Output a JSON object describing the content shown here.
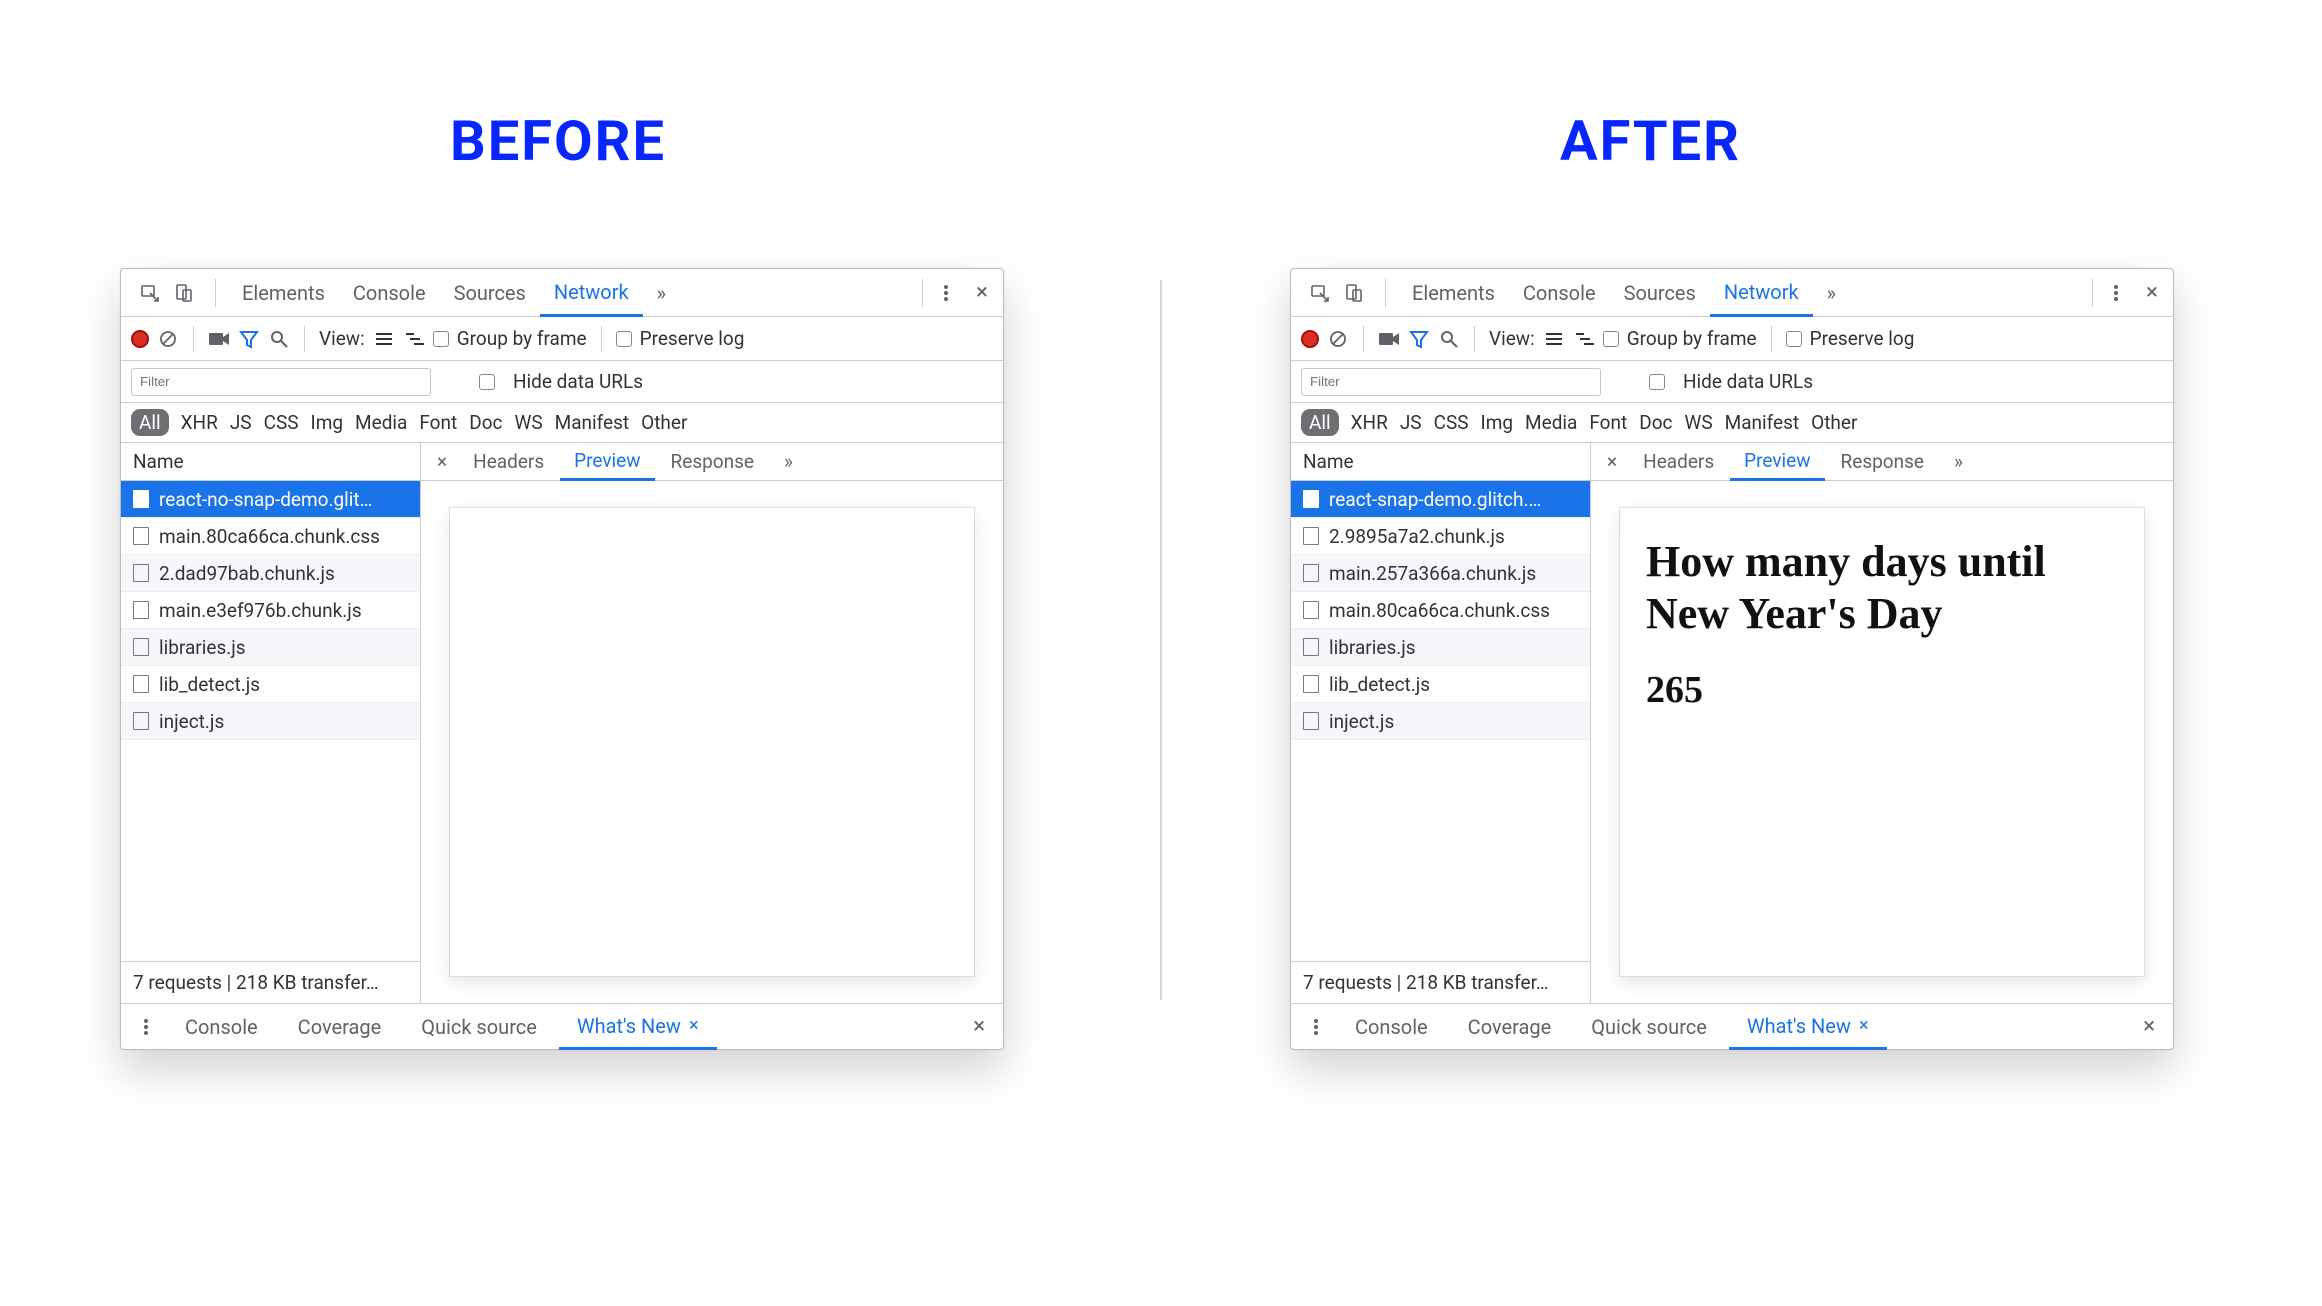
{
  "headings": {
    "before": "BEFORE",
    "after": "AFTER"
  },
  "tabs": {
    "items": [
      "Elements",
      "Console",
      "Sources",
      "Network"
    ],
    "active_index": 3,
    "more_glyph": "»"
  },
  "toolbar": {
    "view_label": "View:",
    "group_by_frame": "Group by frame",
    "preserve_log": "Preserve log"
  },
  "filter": {
    "placeholder": "Filter",
    "hide_data_urls": "Hide data URLs"
  },
  "types": {
    "items": [
      "All",
      "XHR",
      "JS",
      "CSS",
      "Img",
      "Media",
      "Font",
      "Doc",
      "WS",
      "Manifest",
      "Other"
    ],
    "active_index": 0
  },
  "detail_tabs": {
    "items": [
      "Headers",
      "Preview",
      "Response"
    ],
    "active_index": 1,
    "more_glyph": "»",
    "close_glyph": "×"
  },
  "columns": {
    "name": "Name"
  },
  "before": {
    "requests": [
      "react-no-snap-demo.glit…",
      "main.80ca66ca.chunk.css",
      "2.dad97bab.chunk.js",
      "main.e3ef976b.chunk.js",
      "libraries.js",
      "lib_detect.js",
      "inject.js"
    ],
    "selected_index": 0,
    "preview": {
      "has_content": false
    },
    "status": "7 requests | 218 KB transfer…"
  },
  "after": {
    "requests": [
      "react-snap-demo.glitch.…",
      "2.9895a7a2.chunk.js",
      "main.257a366a.chunk.js",
      "main.80ca66ca.chunk.css",
      "libraries.js",
      "lib_detect.js",
      "inject.js"
    ],
    "selected_index": 0,
    "preview": {
      "has_content": true,
      "heading": "How many days until New Year's Day",
      "value": "265"
    },
    "status": "7 requests | 218 KB transfer…"
  },
  "drawer": {
    "items": [
      "Console",
      "Coverage",
      "Quick source",
      "What's New"
    ],
    "active_index": 3,
    "close_glyph": "×"
  }
}
